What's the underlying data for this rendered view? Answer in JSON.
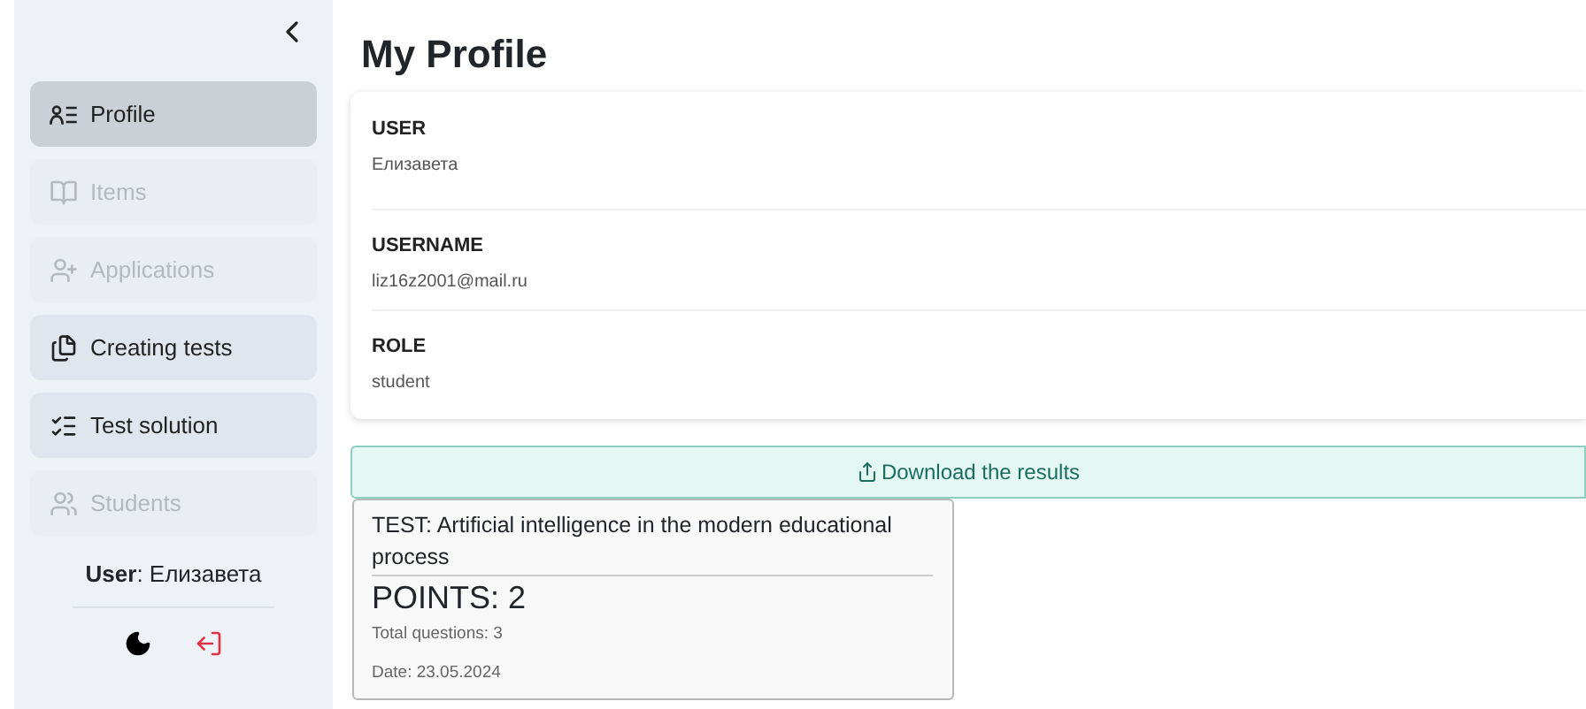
{
  "sidebar": {
    "items": [
      {
        "label": "Profile",
        "selected": true,
        "disabled": false
      },
      {
        "label": "Items",
        "selected": false,
        "disabled": true
      },
      {
        "label": "Applications",
        "selected": false,
        "disabled": true
      },
      {
        "label": "Creating tests",
        "selected": false,
        "disabled": false
      },
      {
        "label": "Test solution",
        "selected": false,
        "disabled": false
      },
      {
        "label": "Students",
        "selected": false,
        "disabled": true
      }
    ],
    "user_label": "User",
    "user_name": ": Елизавета"
  },
  "title": "My Profile",
  "profile": [
    {
      "label": "USER",
      "value": "Елизавета"
    },
    {
      "label": "USERNAME",
      "value": "liz16z2001@mail.ru"
    },
    {
      "label": "ROLE",
      "value": "student"
    }
  ],
  "download_button": "Download the results",
  "result": {
    "test": "TEST: Artificial intelligence in the modern educational process",
    "points": "POINTS: 2",
    "total": "Total questions: 3",
    "date": "Date: 23.05.2024"
  }
}
